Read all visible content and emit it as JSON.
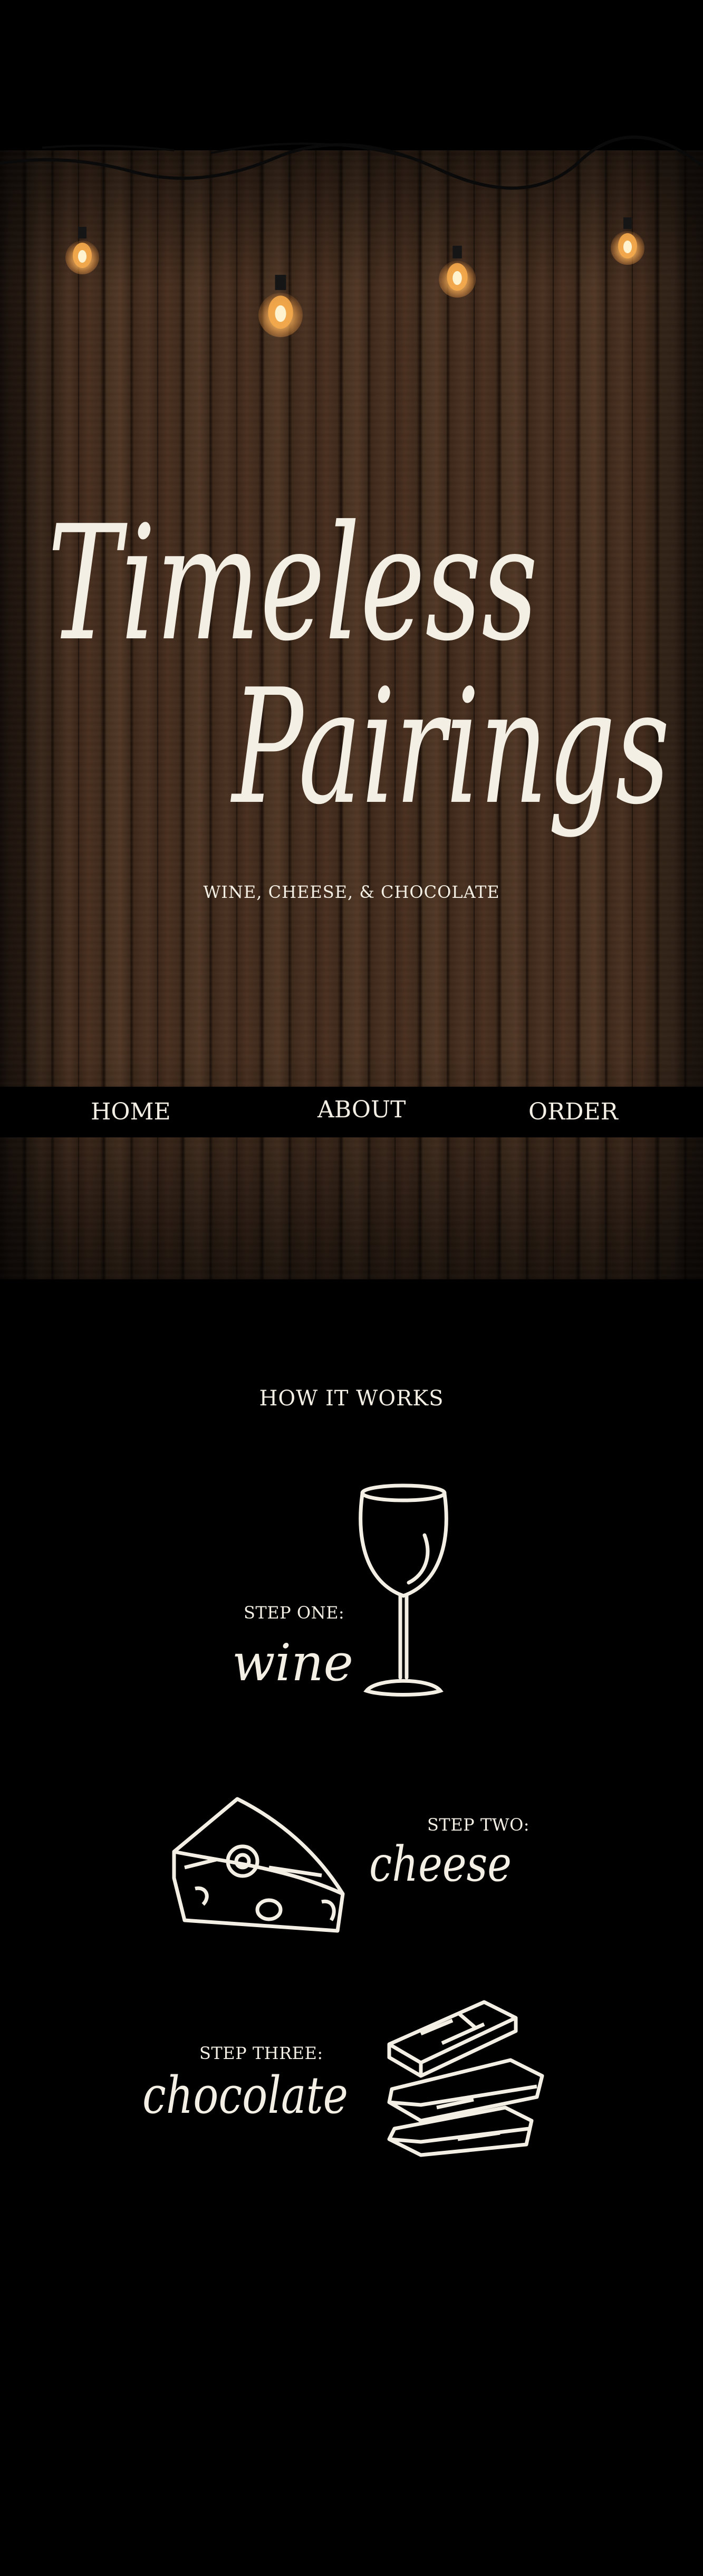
{
  "hero": {
    "title_line1": "Timeless",
    "title_line2": "Pairings",
    "tagline": "WINE, CHEESE, & CHOCOLATE"
  },
  "nav": {
    "home": "HOME",
    "about": "ABOUT",
    "order": "ORDER"
  },
  "how_it_works": {
    "heading": "HOW IT WORKS",
    "steps": [
      {
        "label": "STEP ONE:",
        "word": "wine",
        "icon": "wine-glass-icon"
      },
      {
        "label": "STEP TWO:",
        "word": "cheese",
        "icon": "cheese-icon"
      },
      {
        "label": "STEP THREE:",
        "word": "chocolate",
        "icon": "chocolate-bars-icon"
      }
    ]
  },
  "colors": {
    "background": "#000000",
    "text": "#f4efe4",
    "wood": "#4a3020",
    "bulb_glow": "#ffb35a"
  }
}
